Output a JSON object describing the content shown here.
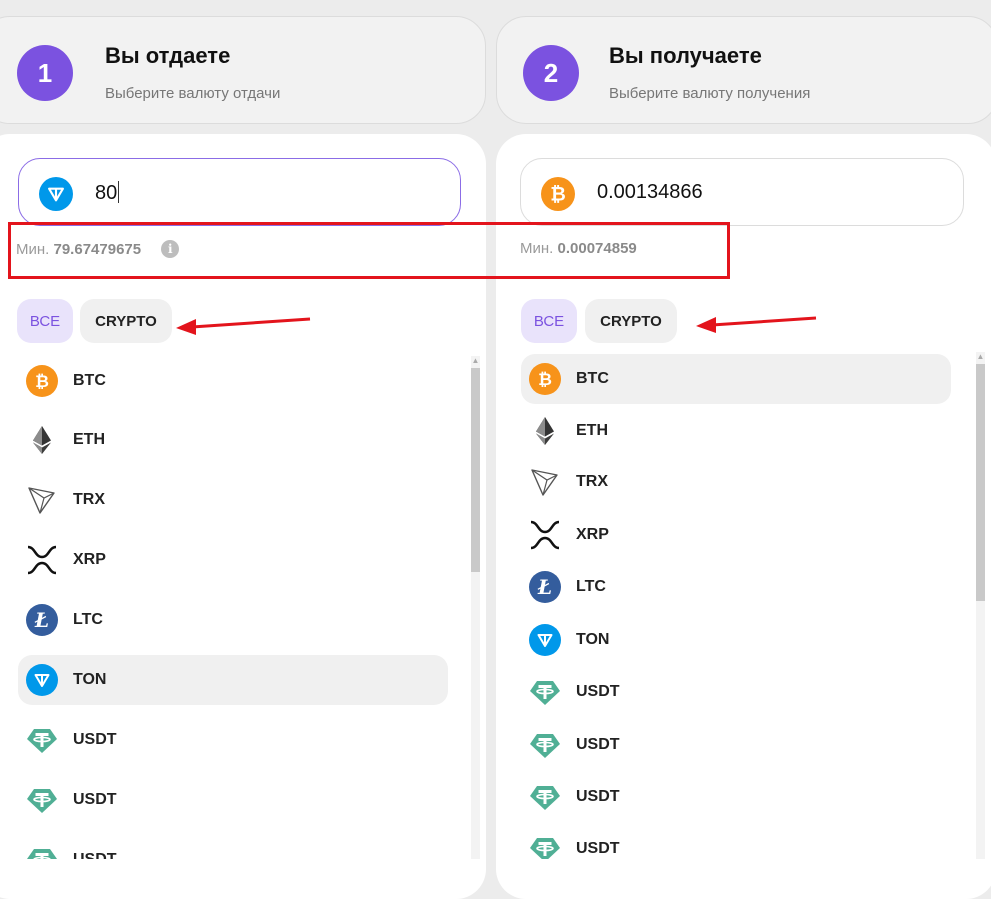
{
  "left": {
    "step_number": "1",
    "title": "Вы отдаете",
    "subtitle": "Выберите валюту отдачи",
    "amount": "80",
    "amount_coin_icon": "ton-icon",
    "min_label": "Мин.",
    "min_value": "79.67479675",
    "filters": {
      "all": "ВСЕ",
      "crypto": "CRYPTO"
    },
    "active_item": "TON",
    "items": [
      "BTC",
      "ETH",
      "TRX",
      "XRP",
      "LTC",
      "TON",
      "USDT",
      "USDT",
      "USDT"
    ]
  },
  "right": {
    "step_number": "2",
    "title": "Вы получаете",
    "subtitle": "Выберите валюту получения",
    "amount": "0.00134866",
    "amount_coin_icon": "btc-icon",
    "min_label": "Мин.",
    "min_value": "0.00074859",
    "filters": {
      "all": "ВСЕ",
      "crypto": "CRYPTO"
    },
    "active_item": "BTC",
    "items": [
      "BTC",
      "ETH",
      "TRX",
      "XRP",
      "LTC",
      "TON",
      "USDT",
      "USDT",
      "USDT",
      "USDT"
    ]
  },
  "colors": {
    "accent": "#7b52e0",
    "annotation": "#e3141c",
    "btc": "#f7931a",
    "ton": "#0098ea",
    "ltc": "#345d9d",
    "usdt": "#50af95"
  }
}
